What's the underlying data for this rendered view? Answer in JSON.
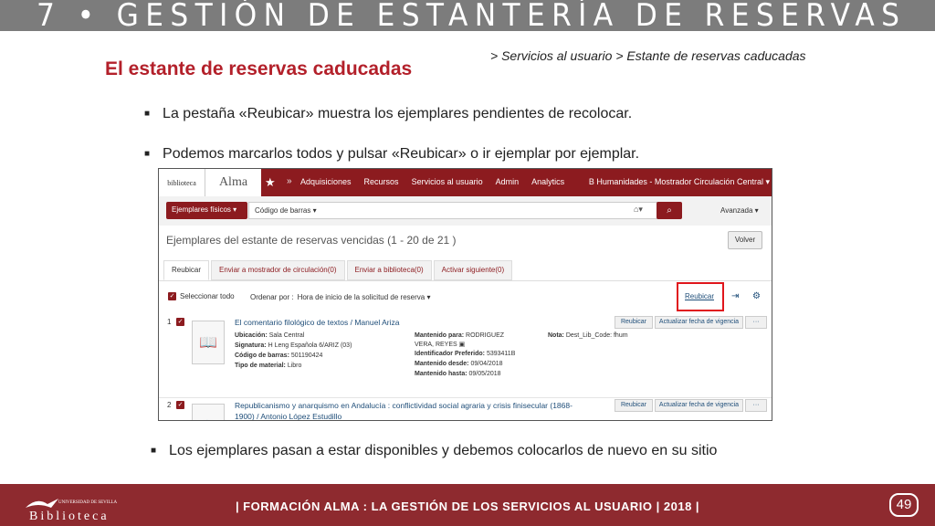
{
  "banner": {
    "title": "7 • GESTIÓN DE ESTANTERÍA DE RESERVAS"
  },
  "breadcrumb": "> Servicios al usuario > Estante de reservas caducadas",
  "slide_title": "El estante de reservas caducadas",
  "bullets": [
    "La pestaña «Reubicar» muestra los ejemplares pendientes de recolocar.",
    "Podemos marcarlos todos y pulsar «Reubicar» o ir ejemplar por ejemplar.",
    "Los ejemplares pasan a estar disponibles y debemos colocarlos de nuevo en su sitio"
  ],
  "alma": {
    "logo_text": "biblioteca",
    "app_name": "Alma",
    "menu": [
      "Adquisiciones",
      "Recursos",
      "Servicios al usuario",
      "Admin",
      "Analytics"
    ],
    "location": "B Humanidades - Mostrador Circulación Central",
    "search": {
      "type": "Ejemplares físicos",
      "field": "Código de barras",
      "advanced": "Avanzada"
    },
    "list_title": "Ejemplares del estante de reservas vencidas (1 - 20 de 21 )",
    "back_button": "Volver",
    "tabs": [
      "Reubicar",
      "Enviar a mostrador de circulación(0)",
      "Enviar a biblioteca(0)",
      "Activar siguiente(0)"
    ],
    "select_all": "Seleccionar todo",
    "sort_label": "Ordenar por :",
    "sort_value": "Hora de inicio de la solicitud de reserva",
    "reubicar_link": "Reubicar",
    "items": [
      {
        "index": "1",
        "title": "El comentario filológico de textos / Manuel Ariza",
        "ubicacion_label": "Ubicación:",
        "ubicacion": "Sala Central",
        "signatura_label": "Signatura:",
        "signatura": "H Leng Española 6/ARIZ (03)",
        "codigo_label": "Código de barras:",
        "codigo": "501190424",
        "tipo_label": "Tipo de material:",
        "tipo": "Libro",
        "mantenido_para_label": "Mantenido para:",
        "mantenido_para": "RODRIGUEZ",
        "mantenido_para2": "VERA, REYES",
        "identificador_label": "Identificador Preferido:",
        "identificador": "5393411B",
        "desde_label": "Mantenido desde:",
        "desde": "09/04/2018",
        "hasta_label": "Mantenido hasta:",
        "hasta": "09/05/2018",
        "nota_label": "Nota:",
        "nota": "Dest_Lib_Code: fhum",
        "btn_reubicar": "Reubicar",
        "btn_fecha": "Actualizar fecha de vigencia",
        "btn_more": "···"
      },
      {
        "index": "2",
        "title": "Republicanismo y anarquismo en Andalucía : conflictividad social agraria y crisis finisecular (1868-",
        "title2": "1900) / Antonio López Estudillo",
        "btn_reubicar": "Reubicar",
        "btn_fecha": "Actualizar fecha de vigencia",
        "btn_more": "···"
      }
    ]
  },
  "footer": {
    "text": "| FORMACIÓN ALMA :  LA GESTIÓN DE LOS SERVICIOS AL USUARIO | 2018 |",
    "logo_top": "UNIVERSIDAD DE SEVILLA",
    "logo_text": "Biblioteca",
    "page": "49"
  }
}
